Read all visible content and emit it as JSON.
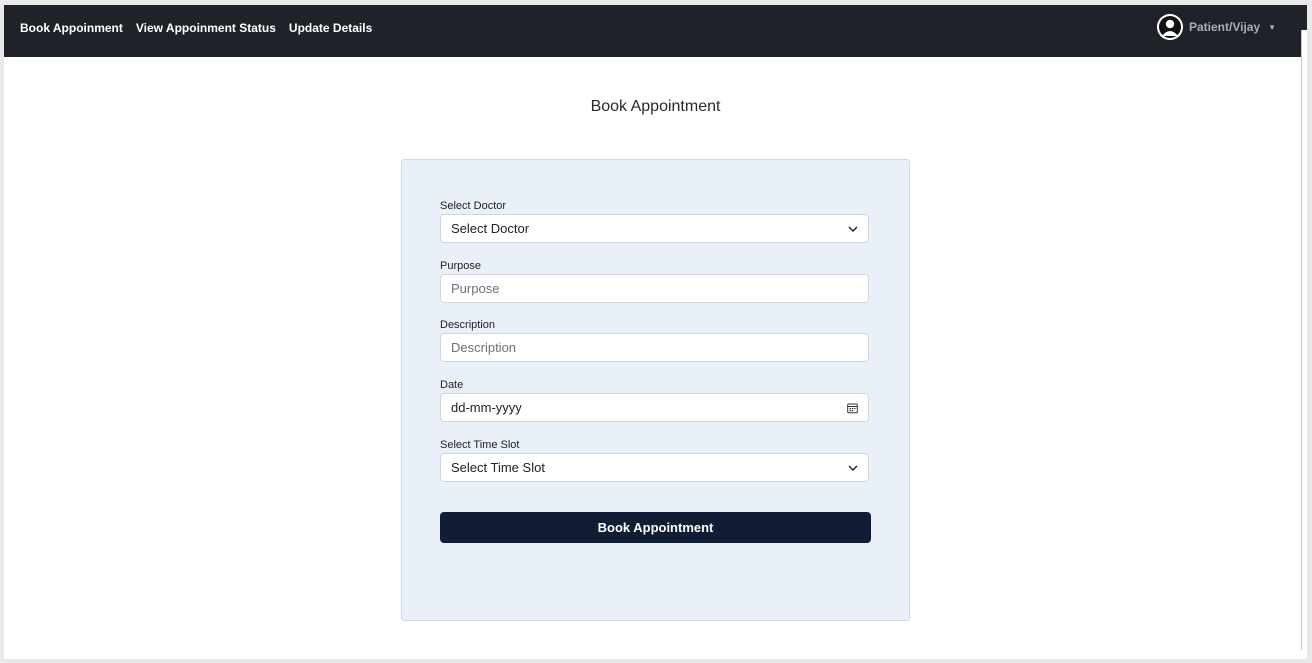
{
  "nav": {
    "links": [
      "Book Appoinment",
      "View Appoinment Status",
      "Update Details"
    ],
    "user_label": "Patient/Vijay",
    "user_icon": "user-avatar-icon",
    "caret_icon": "caret-down-icon"
  },
  "page": {
    "title": "Book Appointment"
  },
  "form": {
    "doctor": {
      "label": "Select Doctor",
      "value": "Select Doctor"
    },
    "purpose": {
      "label": "Purpose",
      "placeholder": "Purpose"
    },
    "description": {
      "label": "Description",
      "placeholder": "Description"
    },
    "date": {
      "label": "Date",
      "placeholder": "dd-mm-yyyy",
      "icon": "calendar-icon"
    },
    "time_slot": {
      "label": "Select Time Slot",
      "value": "Select Time Slot"
    },
    "submit_label": "Book Appointment"
  },
  "colors": {
    "navbar": "#1f2329",
    "card": "#e9f0f8",
    "button": "#111d35"
  }
}
